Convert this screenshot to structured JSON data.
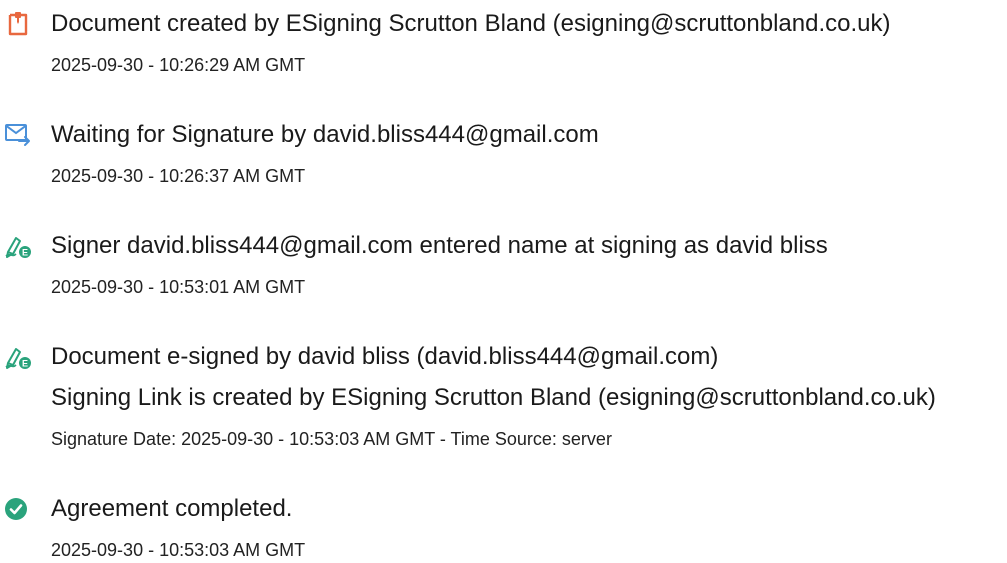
{
  "colors": {
    "doc_icon": "#e8683f",
    "mail_icon": "#4a90d9",
    "sign_icon": "#2aa37c",
    "complete_icon": "#2aa37c",
    "text": "#1a1a1a"
  },
  "events": [
    {
      "icon": "document-icon",
      "title": "Document created by ESigning Scrutton Bland (esigning@scruttonbland.co.uk)",
      "timestamp": "2025-09-30 - 10:26:29 AM GMT"
    },
    {
      "icon": "mail-forward-icon",
      "title": "Waiting for Signature by david.bliss444@gmail.com",
      "timestamp": "2025-09-30 - 10:26:37 AM GMT"
    },
    {
      "icon": "signature-pen-icon",
      "title": "Signer david.bliss444@gmail.com entered name at signing as david bliss",
      "timestamp": "2025-09-30 - 10:53:01 AM GMT"
    },
    {
      "icon": "signature-pen-icon",
      "title": "Document e-signed by david bliss (david.bliss444@gmail.com)",
      "subtitle": "Signing Link is created by ESigning Scrutton Bland (esigning@scruttonbland.co.uk)",
      "timestamp": "Signature Date: 2025-09-30 - 10:53:03 AM GMT - Time Source: server"
    },
    {
      "icon": "check-circle-icon",
      "title": "Agreement completed.",
      "timestamp": "2025-09-30 - 10:53:03 AM GMT"
    }
  ]
}
